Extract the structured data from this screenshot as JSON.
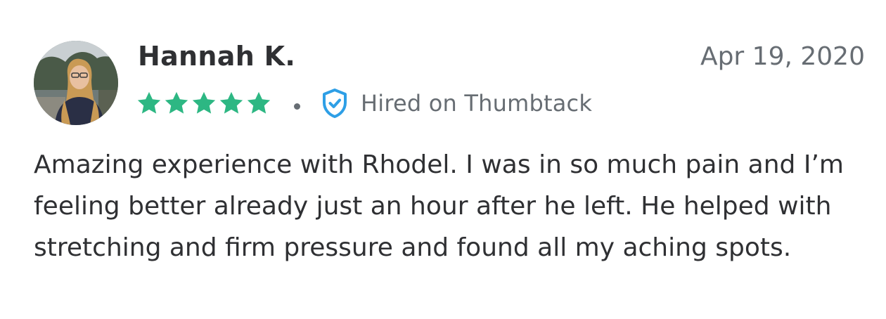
{
  "review": {
    "reviewer_name": "Hannah K.",
    "date": "Apr 19, 2020",
    "rating": 5,
    "rating_max": 5,
    "star_color": "#2db783",
    "verification_label": "Hired on Thumbtack",
    "verification_icon": "shield-check-icon",
    "verification_color": "#2e9fe6",
    "body": "Amazing experience with Rhodel. I was in so much pain and I’m feeling better already just an hour after he left. He helped with stretching and firm pressure and found all my aching spots."
  }
}
